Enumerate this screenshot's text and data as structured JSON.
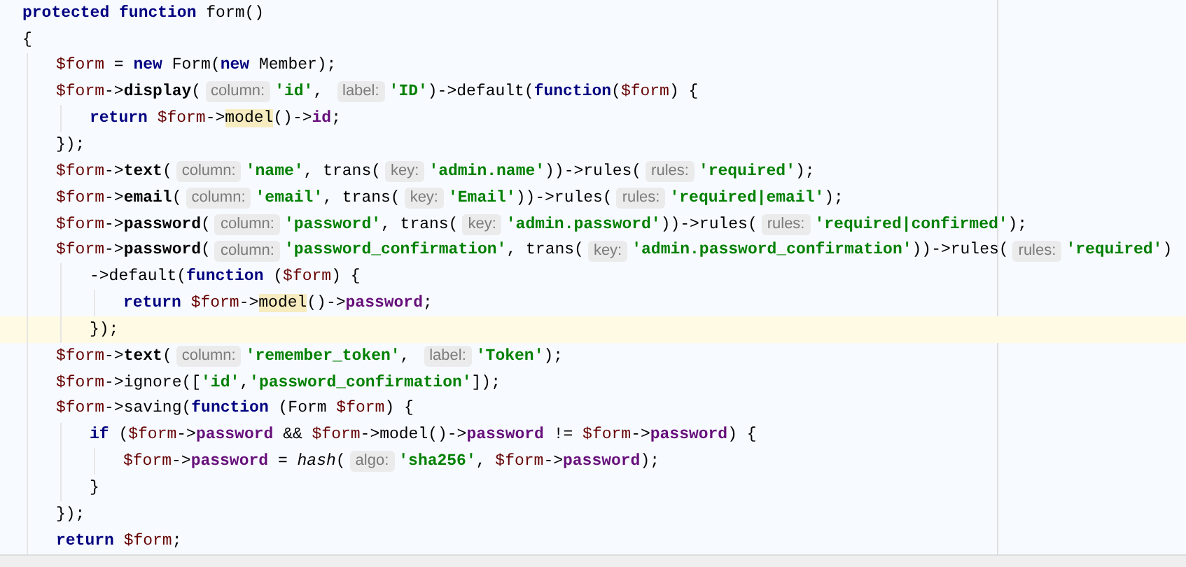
{
  "editor": {
    "lines": [
      {
        "tokens": [
          {
            "kind": "keyword",
            "text": "protected function"
          },
          {
            "kind": "plain",
            "text": " form()"
          }
        ]
      },
      {
        "tokens": [
          {
            "kind": "plain",
            "text": "{"
          }
        ],
        "children": [
          {
            "tokens": [
              {
                "kind": "variable",
                "text": "$form"
              },
              {
                "kind": "plain",
                "text": " = "
              },
              {
                "kind": "keyword",
                "text": "new"
              },
              {
                "kind": "plain",
                "text": " Form("
              },
              {
                "kind": "keyword",
                "text": "new"
              },
              {
                "kind": "plain",
                "text": " Member);"
              }
            ]
          },
          {
            "tokens": [
              {
                "kind": "variable",
                "text": "$form"
              },
              {
                "kind": "plain",
                "text": "->"
              },
              {
                "kind": "method",
                "text": "display"
              },
              {
                "kind": "plain",
                "text": "("
              },
              {
                "kind": "hint",
                "text": "column:"
              },
              {
                "kind": "string",
                "text": "'id'"
              },
              {
                "kind": "plain",
                "text": ", "
              },
              {
                "kind": "hint",
                "text": "label:"
              },
              {
                "kind": "string",
                "text": "'ID'"
              },
              {
                "kind": "plain",
                "text": ")->default("
              },
              {
                "kind": "keyword",
                "text": "function"
              },
              {
                "kind": "plain",
                "text": "("
              },
              {
                "kind": "variable",
                "text": "$form"
              },
              {
                "kind": "plain",
                "text": ") {"
              }
            ],
            "children": [
              {
                "tokens": [
                  {
                    "kind": "keyword",
                    "text": "return "
                  },
                  {
                    "kind": "variable",
                    "text": "$form"
                  },
                  {
                    "kind": "plain",
                    "text": "->"
                  },
                  {
                    "kind": "match",
                    "text": "model"
                  },
                  {
                    "kind": "plain",
                    "text": "()->"
                  },
                  {
                    "kind": "field",
                    "text": "id"
                  },
                  {
                    "kind": "plain",
                    "text": ";"
                  }
                ]
              }
            ]
          },
          {
            "tokens": [
              {
                "kind": "plain",
                "text": "});"
              }
            ]
          },
          {
            "tokens": [
              {
                "kind": "variable",
                "text": "$form"
              },
              {
                "kind": "plain",
                "text": "->"
              },
              {
                "kind": "method",
                "text": "text"
              },
              {
                "kind": "plain",
                "text": "("
              },
              {
                "kind": "hint",
                "text": "column:"
              },
              {
                "kind": "string",
                "text": "'name'"
              },
              {
                "kind": "plain",
                "text": ", trans("
              },
              {
                "kind": "hint",
                "text": "key:"
              },
              {
                "kind": "string",
                "text": "'admin.name'"
              },
              {
                "kind": "plain",
                "text": "))->rules("
              },
              {
                "kind": "hint",
                "text": "rules:"
              },
              {
                "kind": "string",
                "text": "'required'"
              },
              {
                "kind": "plain",
                "text": ");"
              }
            ]
          },
          {
            "tokens": [
              {
                "kind": "variable",
                "text": "$form"
              },
              {
                "kind": "plain",
                "text": "->"
              },
              {
                "kind": "method",
                "text": "email"
              },
              {
                "kind": "plain",
                "text": "("
              },
              {
                "kind": "hint",
                "text": "column:"
              },
              {
                "kind": "string",
                "text": "'email'"
              },
              {
                "kind": "plain",
                "text": ", trans("
              },
              {
                "kind": "hint",
                "text": "key:"
              },
              {
                "kind": "string",
                "text": "'Email'"
              },
              {
                "kind": "plain",
                "text": "))->rules("
              },
              {
                "kind": "hint",
                "text": "rules:"
              },
              {
                "kind": "string",
                "text": "'required|email'"
              },
              {
                "kind": "plain",
                "text": ");"
              }
            ]
          },
          {
            "tokens": [
              {
                "kind": "variable",
                "text": "$form"
              },
              {
                "kind": "plain",
                "text": "->"
              },
              {
                "kind": "method",
                "text": "password"
              },
              {
                "kind": "plain",
                "text": "("
              },
              {
                "kind": "hint",
                "text": "column:"
              },
              {
                "kind": "string",
                "text": "'password'"
              },
              {
                "kind": "plain",
                "text": ", trans("
              },
              {
                "kind": "hint",
                "text": "key:"
              },
              {
                "kind": "string",
                "text": "'admin.password'"
              },
              {
                "kind": "plain",
                "text": "))->rules("
              },
              {
                "kind": "hint",
                "text": "rules:"
              },
              {
                "kind": "string",
                "text": "'required|confirmed'"
              },
              {
                "kind": "plain",
                "text": ");"
              }
            ]
          },
          {
            "tokens": [
              {
                "kind": "variable",
                "text": "$form"
              },
              {
                "kind": "plain",
                "text": "->"
              },
              {
                "kind": "method",
                "text": "password"
              },
              {
                "kind": "plain",
                "text": "("
              },
              {
                "kind": "hint",
                "text": "column:"
              },
              {
                "kind": "string",
                "text": "'password_confirmation'"
              },
              {
                "kind": "plain",
                "text": ", trans("
              },
              {
                "kind": "hint",
                "text": "key:"
              },
              {
                "kind": "string",
                "text": "'admin.password_confirmation'"
              },
              {
                "kind": "plain",
                "text": "))->rules("
              },
              {
                "kind": "hint",
                "text": "rules:"
              },
              {
                "kind": "string",
                "text": "'required'"
              },
              {
                "kind": "plain",
                "text": ")"
              }
            ],
            "children": [
              {
                "tokens": [
                  {
                    "kind": "plain",
                    "text": "->default("
                  },
                  {
                    "kind": "keyword",
                    "text": "function"
                  },
                  {
                    "kind": "plain",
                    "text": " ("
                  },
                  {
                    "kind": "variable",
                    "text": "$form"
                  },
                  {
                    "kind": "plain",
                    "text": ") {"
                  }
                ],
                "children": [
                  {
                    "tokens": [
                      {
                        "kind": "keyword",
                        "text": "return "
                      },
                      {
                        "kind": "variable",
                        "text": "$form"
                      },
                      {
                        "kind": "plain",
                        "text": "->"
                      },
                      {
                        "kind": "match",
                        "text": "model"
                      },
                      {
                        "kind": "plain",
                        "text": "()->"
                      },
                      {
                        "kind": "field",
                        "text": "password"
                      },
                      {
                        "kind": "plain",
                        "text": ";"
                      }
                    ]
                  }
                ]
              },
              {
                "tokens": [
                  {
                    "kind": "plain",
                    "text": "});"
                  }
                ],
                "current": true
              }
            ]
          },
          {
            "tokens": [
              {
                "kind": "variable",
                "text": "$form"
              },
              {
                "kind": "plain",
                "text": "->"
              },
              {
                "kind": "method",
                "text": "text"
              },
              {
                "kind": "plain",
                "text": "("
              },
              {
                "kind": "hint",
                "text": "column:"
              },
              {
                "kind": "string",
                "text": "'remember_token'"
              },
              {
                "kind": "plain",
                "text": ", "
              },
              {
                "kind": "hint",
                "text": "label:"
              },
              {
                "kind": "string",
                "text": "'Token'"
              },
              {
                "kind": "plain",
                "text": ");"
              }
            ]
          },
          {
            "tokens": [
              {
                "kind": "variable",
                "text": "$form"
              },
              {
                "kind": "plain",
                "text": "->ignore(["
              },
              {
                "kind": "string",
                "text": "'id'"
              },
              {
                "kind": "plain",
                "text": ","
              },
              {
                "kind": "string",
                "text": "'password_confirmation'"
              },
              {
                "kind": "plain",
                "text": "]);"
              }
            ]
          },
          {
            "tokens": [
              {
                "kind": "variable",
                "text": "$form"
              },
              {
                "kind": "plain",
                "text": "->saving("
              },
              {
                "kind": "keyword",
                "text": "function"
              },
              {
                "kind": "plain",
                "text": " (Form "
              },
              {
                "kind": "variable",
                "text": "$form"
              },
              {
                "kind": "plain",
                "text": ") {"
              }
            ],
            "children": [
              {
                "tokens": [
                  {
                    "kind": "keyword",
                    "text": "if"
                  },
                  {
                    "kind": "plain",
                    "text": " ("
                  },
                  {
                    "kind": "variable",
                    "text": "$form"
                  },
                  {
                    "kind": "plain",
                    "text": "->"
                  },
                  {
                    "kind": "field",
                    "text": "password"
                  },
                  {
                    "kind": "plain",
                    "text": " && "
                  },
                  {
                    "kind": "variable",
                    "text": "$form"
                  },
                  {
                    "kind": "plain",
                    "text": "->model()->"
                  },
                  {
                    "kind": "field",
                    "text": "password"
                  },
                  {
                    "kind": "plain",
                    "text": " != "
                  },
                  {
                    "kind": "variable",
                    "text": "$form"
                  },
                  {
                    "kind": "plain",
                    "text": "->"
                  },
                  {
                    "kind": "field",
                    "text": "password"
                  },
                  {
                    "kind": "plain",
                    "text": ") {"
                  }
                ],
                "children": [
                  {
                    "tokens": [
                      {
                        "kind": "variable",
                        "text": "$form"
                      },
                      {
                        "kind": "plain",
                        "text": "->"
                      },
                      {
                        "kind": "field",
                        "text": "password"
                      },
                      {
                        "kind": "plain",
                        "text": " = "
                      },
                      {
                        "kind": "function",
                        "text": "hash"
                      },
                      {
                        "kind": "plain",
                        "text": "("
                      },
                      {
                        "kind": "hint",
                        "text": "algo:"
                      },
                      {
                        "kind": "string",
                        "text": "'sha256'"
                      },
                      {
                        "kind": "plain",
                        "text": ", "
                      },
                      {
                        "kind": "variable",
                        "text": "$form"
                      },
                      {
                        "kind": "plain",
                        "text": "->"
                      },
                      {
                        "kind": "field",
                        "text": "password"
                      },
                      {
                        "kind": "plain",
                        "text": ");"
                      }
                    ]
                  }
                ]
              },
              {
                "tokens": [
                  {
                    "kind": "plain",
                    "text": "}"
                  }
                ]
              }
            ]
          },
          {
            "tokens": [
              {
                "kind": "plain",
                "text": "});"
              }
            ]
          },
          {
            "tokens": [
              {
                "kind": "keyword",
                "text": "return "
              },
              {
                "kind": "variable",
                "text": "$form"
              },
              {
                "kind": "plain",
                "text": ";"
              }
            ]
          }
        ]
      }
    ]
  }
}
